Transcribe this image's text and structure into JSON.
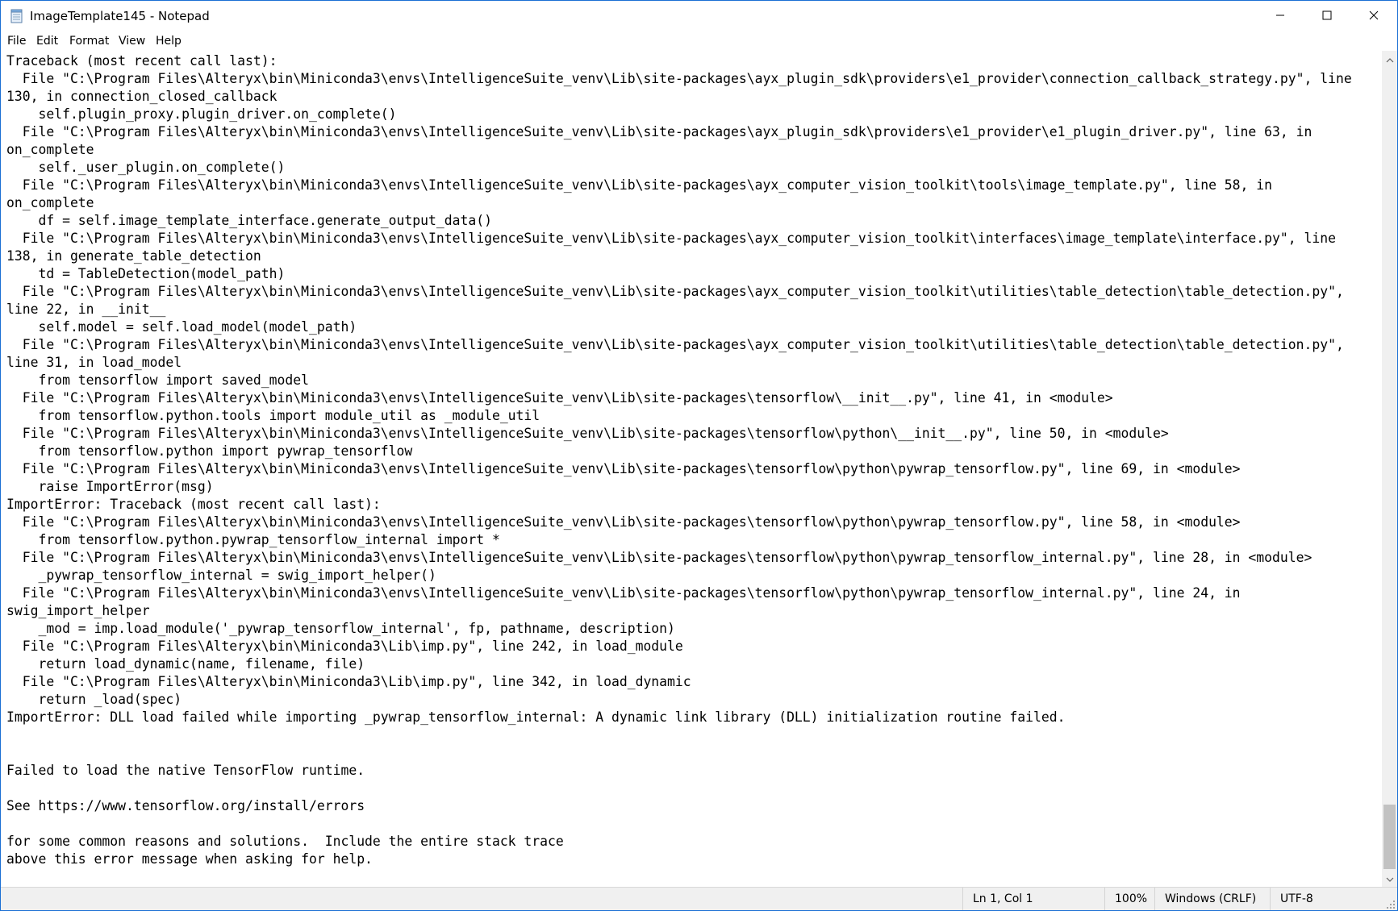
{
  "window": {
    "title": "ImageTemplate145 - Notepad"
  },
  "menu": {
    "items": [
      "File",
      "Edit",
      "Format",
      "View",
      "Help"
    ]
  },
  "editor": {
    "lines": [
      "Traceback (most recent call last):",
      "  File \"C:\\Program Files\\Alteryx\\bin\\Miniconda3\\envs\\IntelligenceSuite_venv\\Lib\\site-packages\\ayx_plugin_sdk\\providers\\e1_provider\\connection_callback_strategy.py\", line",
      "130, in connection_closed_callback",
      "    self.plugin_proxy.plugin_driver.on_complete()",
      "  File \"C:\\Program Files\\Alteryx\\bin\\Miniconda3\\envs\\IntelligenceSuite_venv\\Lib\\site-packages\\ayx_plugin_sdk\\providers\\e1_provider\\e1_plugin_driver.py\", line 63, in",
      "on_complete",
      "    self._user_plugin.on_complete()",
      "  File \"C:\\Program Files\\Alteryx\\bin\\Miniconda3\\envs\\IntelligenceSuite_venv\\Lib\\site-packages\\ayx_computer_vision_toolkit\\tools\\image_template.py\", line 58, in",
      "on_complete",
      "    df = self.image_template_interface.generate_output_data()",
      "  File \"C:\\Program Files\\Alteryx\\bin\\Miniconda3\\envs\\IntelligenceSuite_venv\\Lib\\site-packages\\ayx_computer_vision_toolkit\\interfaces\\image_template\\interface.py\", line",
      "138, in generate_table_detection",
      "    td = TableDetection(model_path)",
      "  File \"C:\\Program Files\\Alteryx\\bin\\Miniconda3\\envs\\IntelligenceSuite_venv\\Lib\\site-packages\\ayx_computer_vision_toolkit\\utilities\\table_detection\\table_detection.py\",",
      "line 22, in __init__",
      "    self.model = self.load_model(model_path)",
      "  File \"C:\\Program Files\\Alteryx\\bin\\Miniconda3\\envs\\IntelligenceSuite_venv\\Lib\\site-packages\\ayx_computer_vision_toolkit\\utilities\\table_detection\\table_detection.py\",",
      "line 31, in load_model",
      "    from tensorflow import saved_model",
      "  File \"C:\\Program Files\\Alteryx\\bin\\Miniconda3\\envs\\IntelligenceSuite_venv\\Lib\\site-packages\\tensorflow\\__init__.py\", line 41, in <module>",
      "    from tensorflow.python.tools import module_util as _module_util",
      "  File \"C:\\Program Files\\Alteryx\\bin\\Miniconda3\\envs\\IntelligenceSuite_venv\\Lib\\site-packages\\tensorflow\\python\\__init__.py\", line 50, in <module>",
      "    from tensorflow.python import pywrap_tensorflow",
      "  File \"C:\\Program Files\\Alteryx\\bin\\Miniconda3\\envs\\IntelligenceSuite_venv\\Lib\\site-packages\\tensorflow\\python\\pywrap_tensorflow.py\", line 69, in <module>",
      "    raise ImportError(msg)",
      "ImportError: Traceback (most recent call last):",
      "  File \"C:\\Program Files\\Alteryx\\bin\\Miniconda3\\envs\\IntelligenceSuite_venv\\Lib\\site-packages\\tensorflow\\python\\pywrap_tensorflow.py\", line 58, in <module>",
      "    from tensorflow.python.pywrap_tensorflow_internal import *",
      "  File \"C:\\Program Files\\Alteryx\\bin\\Miniconda3\\envs\\IntelligenceSuite_venv\\Lib\\site-packages\\tensorflow\\python\\pywrap_tensorflow_internal.py\", line 28, in <module>",
      "    _pywrap_tensorflow_internal = swig_import_helper()",
      "  File \"C:\\Program Files\\Alteryx\\bin\\Miniconda3\\envs\\IntelligenceSuite_venv\\Lib\\site-packages\\tensorflow\\python\\pywrap_tensorflow_internal.py\", line 24, in",
      "swig_import_helper",
      "    _mod = imp.load_module('_pywrap_tensorflow_internal', fp, pathname, description)",
      "  File \"C:\\Program Files\\Alteryx\\bin\\Miniconda3\\Lib\\imp.py\", line 242, in load_module",
      "    return load_dynamic(name, filename, file)",
      "  File \"C:\\Program Files\\Alteryx\\bin\\Miniconda3\\Lib\\imp.py\", line 342, in load_dynamic",
      "    return _load(spec)",
      "ImportError: DLL load failed while importing _pywrap_tensorflow_internal: A dynamic link library (DLL) initialization routine failed.",
      "",
      "",
      "Failed to load the native TensorFlow runtime.",
      "",
      "See https://www.tensorflow.org/install/errors",
      "",
      "for some common reasons and solutions.  Include the entire stack trace",
      "above this error message when asking for help."
    ]
  },
  "status": {
    "position": "Ln 1, Col 1",
    "zoom": "100%",
    "line_ending": "Windows (CRLF)",
    "encoding": "UTF-8"
  },
  "icons": {
    "app": "notepad-icon",
    "minimize": "minimize-icon",
    "maximize": "maximize-icon",
    "close": "close-icon",
    "scroll_up": "chevron-up-icon",
    "scroll_down": "chevron-down-icon",
    "resize_grip": "resize-grip-icon"
  },
  "colors": {
    "accent_border": "#1b6fd4",
    "statusbar_bg": "#f0f0f0",
    "scroll_thumb": "#c2c2c2"
  }
}
